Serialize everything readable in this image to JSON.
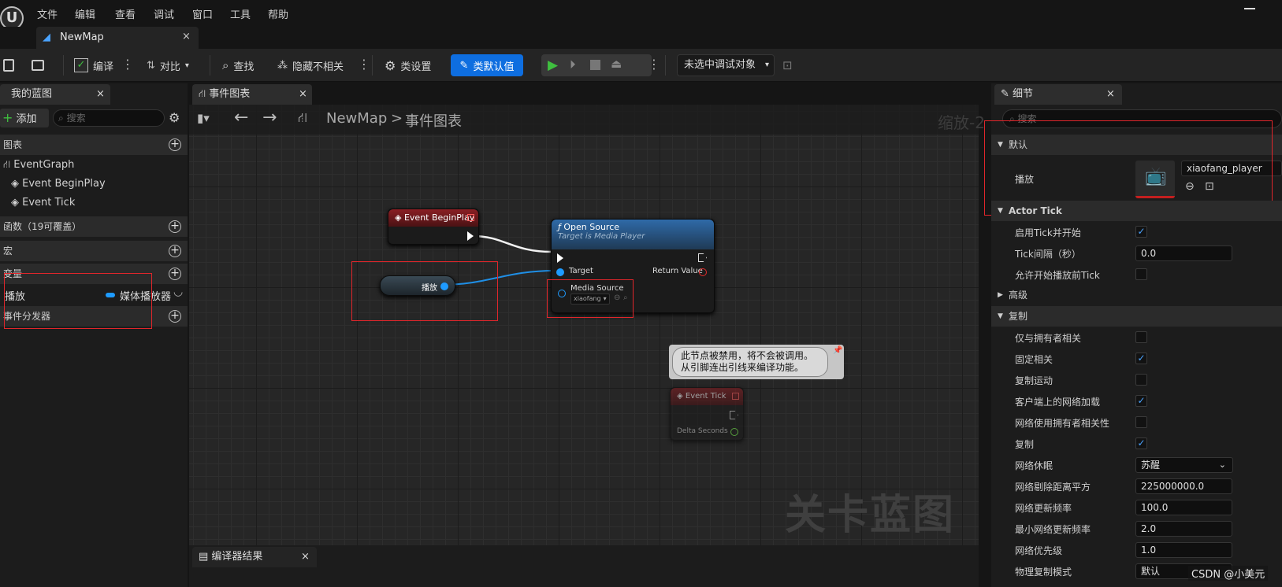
{
  "menu": [
    "文件",
    "编辑",
    "查看",
    "调试",
    "窗口",
    "工具",
    "帮助"
  ],
  "tab": {
    "label": "NewMap",
    "close": "×"
  },
  "toolbar": {
    "compile": "编译",
    "diff": "对比",
    "find": "查找",
    "hide_unrelated": "隐藏不相关",
    "class_settings": "类设置",
    "class_defaults": "类默认值",
    "debug_object": "未选中调试对象"
  },
  "left": {
    "tab": "我的蓝图",
    "close": "×",
    "add": "添加",
    "search_placeholder": "搜索",
    "sections": {
      "graphs": "图表",
      "functions": "函数（19可覆盖）",
      "macros": "宏",
      "variables": "变量",
      "dispatchers": "事件分发器"
    },
    "graph_items": [
      "EventGraph",
      "Event BeginPlay",
      "Event Tick"
    ],
    "variable": {
      "name": "播放",
      "type": "媒体播放器"
    }
  },
  "graph": {
    "tab": "事件图表",
    "close": "×",
    "breadcrumb_root": "NewMap",
    "breadcrumb_sep": ">",
    "breadcrumb_current": "事件图表",
    "zoom": "缩放-2",
    "watermark": "关卡蓝图",
    "nodes": {
      "begin_play": "Event BeginPlay",
      "open_source": {
        "title": "Open Source",
        "subtitle": "Target is Media Player",
        "target": "Target",
        "return": "Return Value",
        "media_source": "Media Source",
        "media_value": "xiaofang"
      },
      "variable_get": "播放",
      "event_tick": "Event Tick",
      "delta_seconds": "Delta Seconds",
      "disabled_comment": "此节点被禁用，将不会被调用。\n从引脚连出引线来编译功能。"
    }
  },
  "compiler": {
    "tab": "编译器结果",
    "close": "×"
  },
  "details": {
    "tab": "细节",
    "close": "×",
    "search_placeholder": "搜索",
    "default_section": "默认",
    "play_label": "播放",
    "play_asset": "xiaofang_player",
    "actor_tick": "Actor Tick",
    "rows": [
      {
        "label": "启用Tick并开始",
        "type": "cb",
        "checked": true
      },
      {
        "label": "Tick间隔（秒）",
        "type": "num",
        "value": "0.0"
      },
      {
        "label": "允许开始播放前Tick",
        "type": "cb",
        "checked": false
      }
    ],
    "advanced": "高级",
    "replication": "复制",
    "rep_rows": [
      {
        "label": "仅与拥有者相关",
        "type": "cb",
        "checked": false
      },
      {
        "label": "固定相关",
        "type": "cb",
        "checked": true
      },
      {
        "label": "复制运动",
        "type": "cb",
        "checked": false
      },
      {
        "label": "客户端上的网络加载",
        "type": "cb",
        "checked": true
      },
      {
        "label": "网络使用拥有者相关性",
        "type": "cb",
        "checked": false
      },
      {
        "label": "复制",
        "type": "cb",
        "checked": true
      },
      {
        "label": "网络休眠",
        "type": "sel",
        "value": "苏醒"
      },
      {
        "label": "网络剔除距离平方",
        "type": "num",
        "value": "225000000.0"
      },
      {
        "label": "网络更新频率",
        "type": "num",
        "value": "100.0"
      },
      {
        "label": "最小网络更新频率",
        "type": "num",
        "value": "2.0"
      },
      {
        "label": "网络优先级",
        "type": "num",
        "value": "1.0"
      },
      {
        "label": "物理复制模式",
        "type": "num",
        "value": "默认"
      }
    ]
  },
  "watermark_footer": "CSDN @小美元"
}
